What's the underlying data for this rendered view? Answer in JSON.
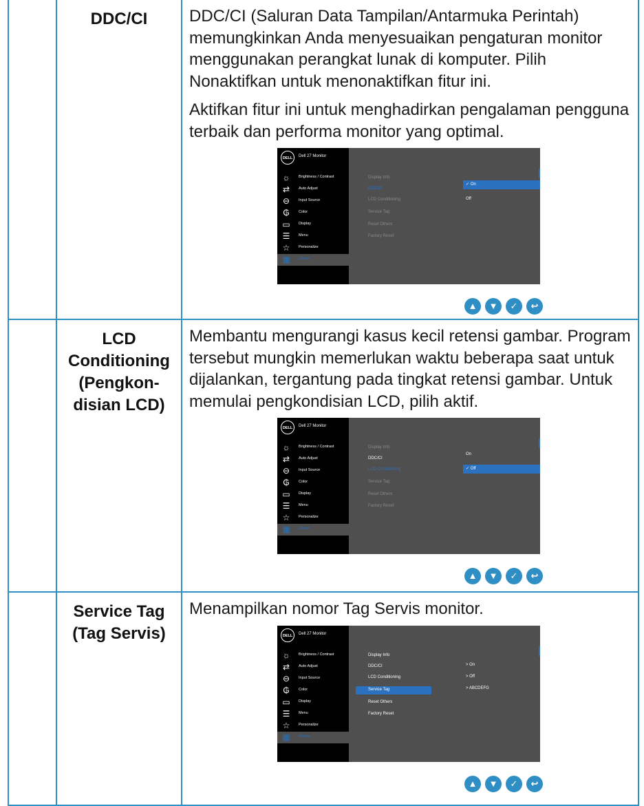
{
  "rows": [
    {
      "term": "DDC/CI",
      "desc": [
        "DDC/CI (Saluran Data Tampilan/Antarmuka Perintah) memungkinkan Anda menyesuaikan pengaturan monitor menggunakan perangkat lunak di komputer. Pilih Nonaktifkan untuk menonaktifkan fitur ini.",
        "Aktifkan fitur ini untuk menghadirkan pengalaman pengguna terbaik dan performa monitor yang optimal."
      ]
    },
    {
      "term": "LCD Conditioning (Pengkon-disian LCD)",
      "desc": [
        "Membantu mengurangi kasus kecil retensi gambar. Program tersebut mungkin memerlukan waktu beberapa saat untuk dijalankan, tergantung pada tingkat retensi gambar. Untuk memulai pengkondisian LCD, pilih aktif."
      ]
    },
    {
      "term": "Service Tag (Tag Servis)",
      "desc": [
        "Menampilkan nomor Tag Servis monitor."
      ]
    }
  ],
  "osd": {
    "logo": "DELL",
    "title": "Dell 27 Monitor",
    "menu": [
      {
        "label": "Brightness / Contrast",
        "icon": "brightness-icon"
      },
      {
        "label": "Auto Adjust",
        "icon": "auto-adjust-icon"
      },
      {
        "label": "Input Source",
        "icon": "input-source-icon"
      },
      {
        "label": "Color",
        "icon": "color-icon"
      },
      {
        "label": "Display",
        "icon": "display-icon"
      },
      {
        "label": "Menu",
        "icon": "menu-icon"
      },
      {
        "label": "Personalize",
        "icon": "star-icon"
      },
      {
        "label": "Others",
        "icon": "others-icon"
      }
    ],
    "submenu": [
      "Display Info",
      "DDC/CI",
      "LCD Conditioning",
      "Service Tag",
      "Reset Others",
      "Factory Reset"
    ],
    "shot1_options": [
      "✓ On",
      "Off"
    ],
    "shot2_options": [
      "On",
      "✓ Off"
    ],
    "shot3_values": [
      "> On",
      "> Off",
      "> ABCDEFG"
    ]
  },
  "buttons": [
    "up-button",
    "down-button",
    "check-button",
    "back-button"
  ]
}
